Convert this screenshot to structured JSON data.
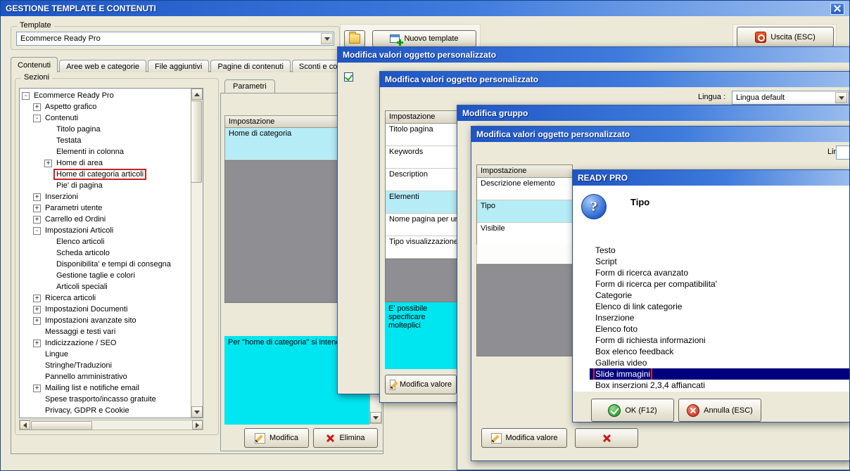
{
  "window": {
    "title": "GESTIONE TEMPLATE E CONTENUTI",
    "template": {
      "group_label": "Template",
      "combo_value": "Ecommerce Ready Pro",
      "new_template": "Nuovo template",
      "exit": "Uscita (ESC)"
    },
    "tabs": [
      {
        "label": "Contenuti",
        "active": true
      },
      {
        "label": "Aree web e categorie"
      },
      {
        "label": "File aggiuntivi"
      },
      {
        "label": "Pagine di contenuti"
      },
      {
        "label": "Sconti e coupon"
      }
    ],
    "sezioni_label": "Sezioni",
    "tree": [
      {
        "label": "Ecommerce Ready Pro",
        "level": 0,
        "glyph": "-"
      },
      {
        "label": "Aspetto grafico",
        "level": 1,
        "glyph": "+"
      },
      {
        "label": "Contenuti",
        "level": 1,
        "glyph": "-"
      },
      {
        "label": "Titolo pagina",
        "level": 2
      },
      {
        "label": "Testata",
        "level": 2
      },
      {
        "label": "Elementi in colonna",
        "level": 2
      },
      {
        "label": "Home di area",
        "level": 2,
        "glyph": "+"
      },
      {
        "label": "Home di categoria articoli",
        "level": 2,
        "annotated": true
      },
      {
        "label": "Pie' di pagina",
        "level": 2
      },
      {
        "label": "Inserzioni",
        "level": 1,
        "glyph": "+"
      },
      {
        "label": "Parametri utente",
        "level": 1,
        "glyph": "+"
      },
      {
        "label": "Carrello ed Ordini",
        "level": 1,
        "glyph": "+"
      },
      {
        "label": "Impostazioni Articoli",
        "level": 1,
        "glyph": "-"
      },
      {
        "label": "Elenco articoli",
        "level": 2
      },
      {
        "label": "Scheda articolo",
        "level": 2
      },
      {
        "label": "Disponibilita' e tempi di consegna",
        "level": 2
      },
      {
        "label": "Gestione taglie e colori",
        "level": 2
      },
      {
        "label": "Articoli speciali",
        "level": 2
      },
      {
        "label": "Ricerca articoli",
        "level": 1,
        "glyph": "+"
      },
      {
        "label": "Impostazioni Documenti",
        "level": 1,
        "glyph": "+"
      },
      {
        "label": "Impostazioni avanzate sito",
        "level": 1,
        "glyph": "+"
      },
      {
        "label": "Messaggi e testi vari",
        "level": 1
      },
      {
        "label": "Indicizzazione / SEO",
        "level": 1,
        "glyph": "+"
      },
      {
        "label": "Lingue",
        "level": 1
      },
      {
        "label": "Stringhe/Traduzioni",
        "level": 1
      },
      {
        "label": "Pannello amministrativo",
        "level": 1
      },
      {
        "label": "Mailing list e notifiche email",
        "level": 1,
        "glyph": "+"
      },
      {
        "label": "Spese trasporto/incasso gratuite",
        "level": 1
      },
      {
        "label": "Privacy, GDPR e Cookie",
        "level": 1
      }
    ],
    "parametri_tab": "Parametri",
    "param_table": {
      "header": "Impostazione",
      "rows": [
        {
          "label": "Home di categoria",
          "selected": true
        }
      ]
    },
    "info_text": "Per \"home di categoria\" si intend",
    "modifica": "Modifica",
    "elimina": "Elimina"
  },
  "dialog_values1": {
    "title": "Modifica valori oggetto personalizzato"
  },
  "dialog_values2": {
    "title": "Modifica valori oggetto personalizzato",
    "lingua_label": "Lingua :",
    "lingua_value": "Lingua default",
    "table_header": "Impostazione",
    "rows": [
      {
        "label": "Titolo pagina"
      },
      {
        "label": "Keywords"
      },
      {
        "label": "Description"
      },
      {
        "label": "Elementi",
        "selected": true
      },
      {
        "label": "Nome pagina per url rewriting"
      },
      {
        "label": "Tipo visualizzazione"
      }
    ],
    "info_text": "E' possibile specificare molteplici",
    "modifica_valore": "Modifica valore"
  },
  "dialog_gruppo": {
    "title": "Modifica gruppo"
  },
  "dialog_values3": {
    "title": "Modifica valori oggetto personalizzato",
    "lingua_label": "Lingua",
    "table_header": "Impostazione",
    "rows": [
      {
        "label": "Descrizione elemento"
      },
      {
        "label": "Tipo",
        "selected": true
      },
      {
        "label": "Visibile"
      }
    ],
    "modifica_valore": "Modifica valore"
  },
  "tipo_dialog": {
    "title": "READY PRO",
    "heading": "Tipo",
    "options": [
      {
        "label": "Testo"
      },
      {
        "label": "Script"
      },
      {
        "label": "Form di ricerca avanzato"
      },
      {
        "label": "Form di ricerca per compatibilita'"
      },
      {
        "label": "Categorie"
      },
      {
        "label": "Elenco di link categorie"
      },
      {
        "label": "Inserzione"
      },
      {
        "label": "Elenco foto"
      },
      {
        "label": "Form di richiesta informazioni"
      },
      {
        "label": "Box elenco feedback"
      },
      {
        "label": "Galleria video"
      },
      {
        "label": "Slide immagini",
        "selected": true,
        "annotated": true
      },
      {
        "label": "Box inserzioni 2,3,4 affiancati"
      }
    ],
    "ok": "OK (F12)",
    "annulla": "Annulla (ESC)"
  },
  "colors": {
    "titlebar_blue": "#2E63CE",
    "selection_cyan": "#B6ECF6",
    "info_cyan": "#00E6F0",
    "annotation_red": "#CC1A1A",
    "selected_navy": "#00007E",
    "window_beige": "#ECE9D8"
  }
}
